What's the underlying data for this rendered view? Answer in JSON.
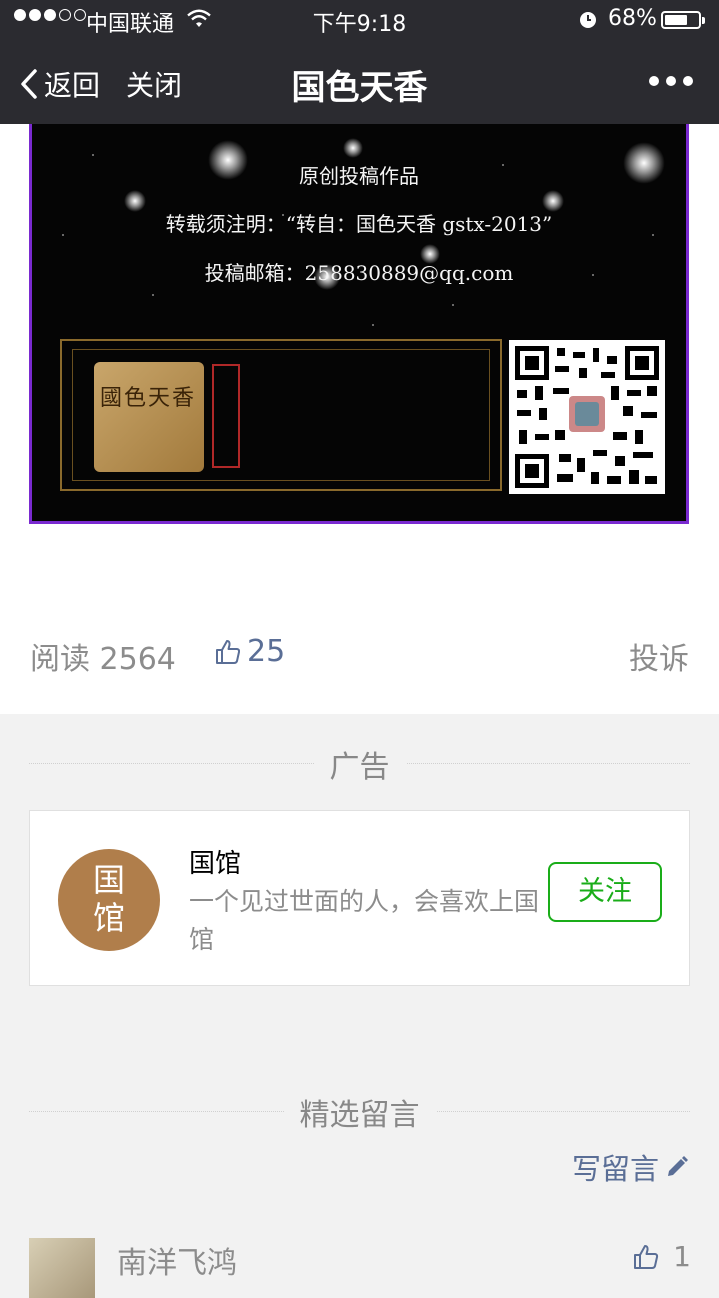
{
  "status_bar": {
    "carrier": "中国联通",
    "time": "下午9:18",
    "battery": "68%",
    "battery_level": 0.68
  },
  "nav": {
    "back_label": "返回",
    "close_label": "关闭",
    "title": "国色天香"
  },
  "banner": {
    "line1": "原创投稿作品",
    "line2": "转载须注明：“转自：国色天香 gstx-2013”",
    "line3": "投稿邮箱：258830889@qq.com"
  },
  "stats": {
    "read_label": "阅读",
    "read_count": "2564",
    "like_count": "25",
    "report_label": "投诉"
  },
  "ad": {
    "section_label": "广告",
    "logo_text": "国\n馆",
    "name": "国馆",
    "description": "一个见过世面的人，会喜欢上国馆",
    "follow_label": "关注",
    "accent_color": "#1aad19"
  },
  "comments": {
    "section_label": "精选留言",
    "write_label": "写留言",
    "items": [
      {
        "name": "南洋飞鸿",
        "likes": "1"
      }
    ]
  }
}
